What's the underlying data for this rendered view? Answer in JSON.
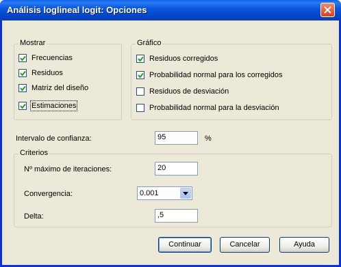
{
  "window": {
    "title": "Análisis loglineal logit: Opciones",
    "close_label": "close"
  },
  "mostrar": {
    "label": "Mostrar",
    "items": [
      {
        "label": "Frecuencias",
        "checked": true
      },
      {
        "label": "Residuos",
        "checked": true
      },
      {
        "label": "Matriz del diseño",
        "checked": true
      },
      {
        "label": "Estimaciones",
        "checked": true
      }
    ]
  },
  "grafico": {
    "label": "Gráfico",
    "items": [
      {
        "label": "Residuos corregidos",
        "checked": true
      },
      {
        "label": "Probabilidad normal para los corregidos",
        "checked": true
      },
      {
        "label": "Residuos de desviación",
        "checked": false
      },
      {
        "label": "Probabilidad normal para la desviación",
        "checked": false
      }
    ]
  },
  "intervalo": {
    "label": "Intervalo de confianza:",
    "value": "95",
    "unit": "%"
  },
  "criterios": {
    "label": "Criterios",
    "iteraciones_label": "Nº máximo de iteraciones:",
    "iteraciones_value": "20",
    "convergencia_label": "Convergencia:",
    "convergencia_value": "0.001",
    "delta_label": "Delta:",
    "delta_value": ",5"
  },
  "buttons": {
    "continuar": "Continuar",
    "cancelar": "Cancelar",
    "ayuda": "Ayuda"
  },
  "colors": {
    "titlebar": "#0A57E0",
    "dialog_bg": "#ECE9D8",
    "checkmark": "#21A121"
  }
}
